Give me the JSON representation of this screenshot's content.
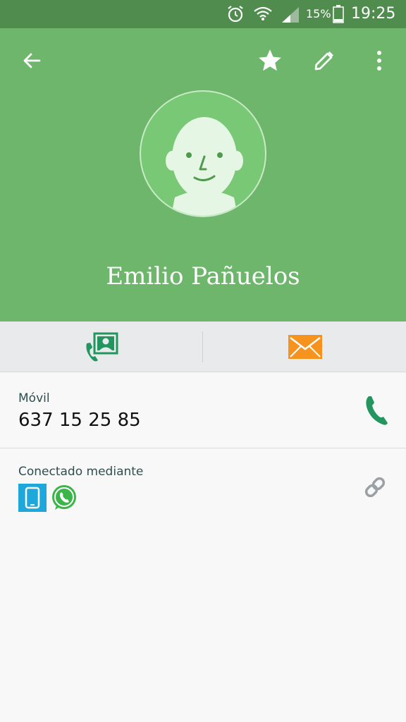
{
  "status_bar": {
    "battery_percent": "15%",
    "time": "19:25",
    "icons": [
      "alarm-icon",
      "wifi-icon",
      "signal-icon",
      "battery-icon"
    ]
  },
  "header": {
    "background": "#6db66c",
    "contact_name": "Emilio Pañuelos",
    "icons": [
      "back-arrow-icon",
      "star-icon",
      "edit-pencil-icon",
      "more-vert-icon"
    ]
  },
  "actions": {
    "icons": [
      "call-contact-icon",
      "message-envelope-icon"
    ],
    "message_color": "#f6931e"
  },
  "phone_row": {
    "label": "Móvil",
    "number": "637 15 25 85",
    "icon": "phone-icon",
    "accent": "#23955f"
  },
  "connected_row": {
    "label": "Conectado mediante",
    "apps": [
      "phone-app-icon",
      "whatsapp-icon"
    ],
    "icon": "link-icon"
  }
}
